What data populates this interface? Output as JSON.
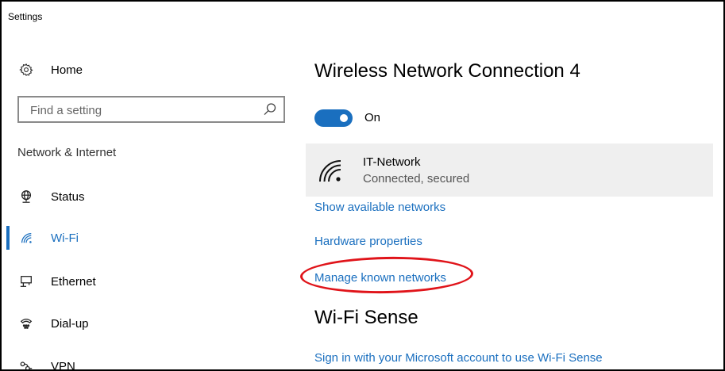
{
  "window": {
    "title": "Settings"
  },
  "sidebar": {
    "home_label": "Home",
    "search": {
      "placeholder": "Find a setting",
      "value": ""
    },
    "section_label": "Network & Internet",
    "items": [
      {
        "label": "Status",
        "icon": "globe-icon"
      },
      {
        "label": "Wi-Fi",
        "icon": "wifi-icon",
        "selected": true
      },
      {
        "label": "Ethernet",
        "icon": "ethernet-icon"
      },
      {
        "label": "Dial-up",
        "icon": "dialup-icon"
      },
      {
        "label": "VPN",
        "icon": "vpn-icon"
      }
    ]
  },
  "main": {
    "title": "Wireless Network Connection 4",
    "toggle": {
      "state": "on",
      "label": "On"
    },
    "network": {
      "name": "IT-Network",
      "status": "Connected, secured"
    },
    "links": {
      "show_available": "Show available networks",
      "hardware_properties": "Hardware properties",
      "manage_known": "Manage known networks"
    },
    "wifi_sense": {
      "title": "Wi-Fi Sense",
      "sign_in_link": "Sign in with your Microsoft account to use Wi-Fi Sense"
    }
  },
  "colors": {
    "accent": "#1a6fbf",
    "annotation": "#e0141a",
    "card_background": "#efefef"
  }
}
